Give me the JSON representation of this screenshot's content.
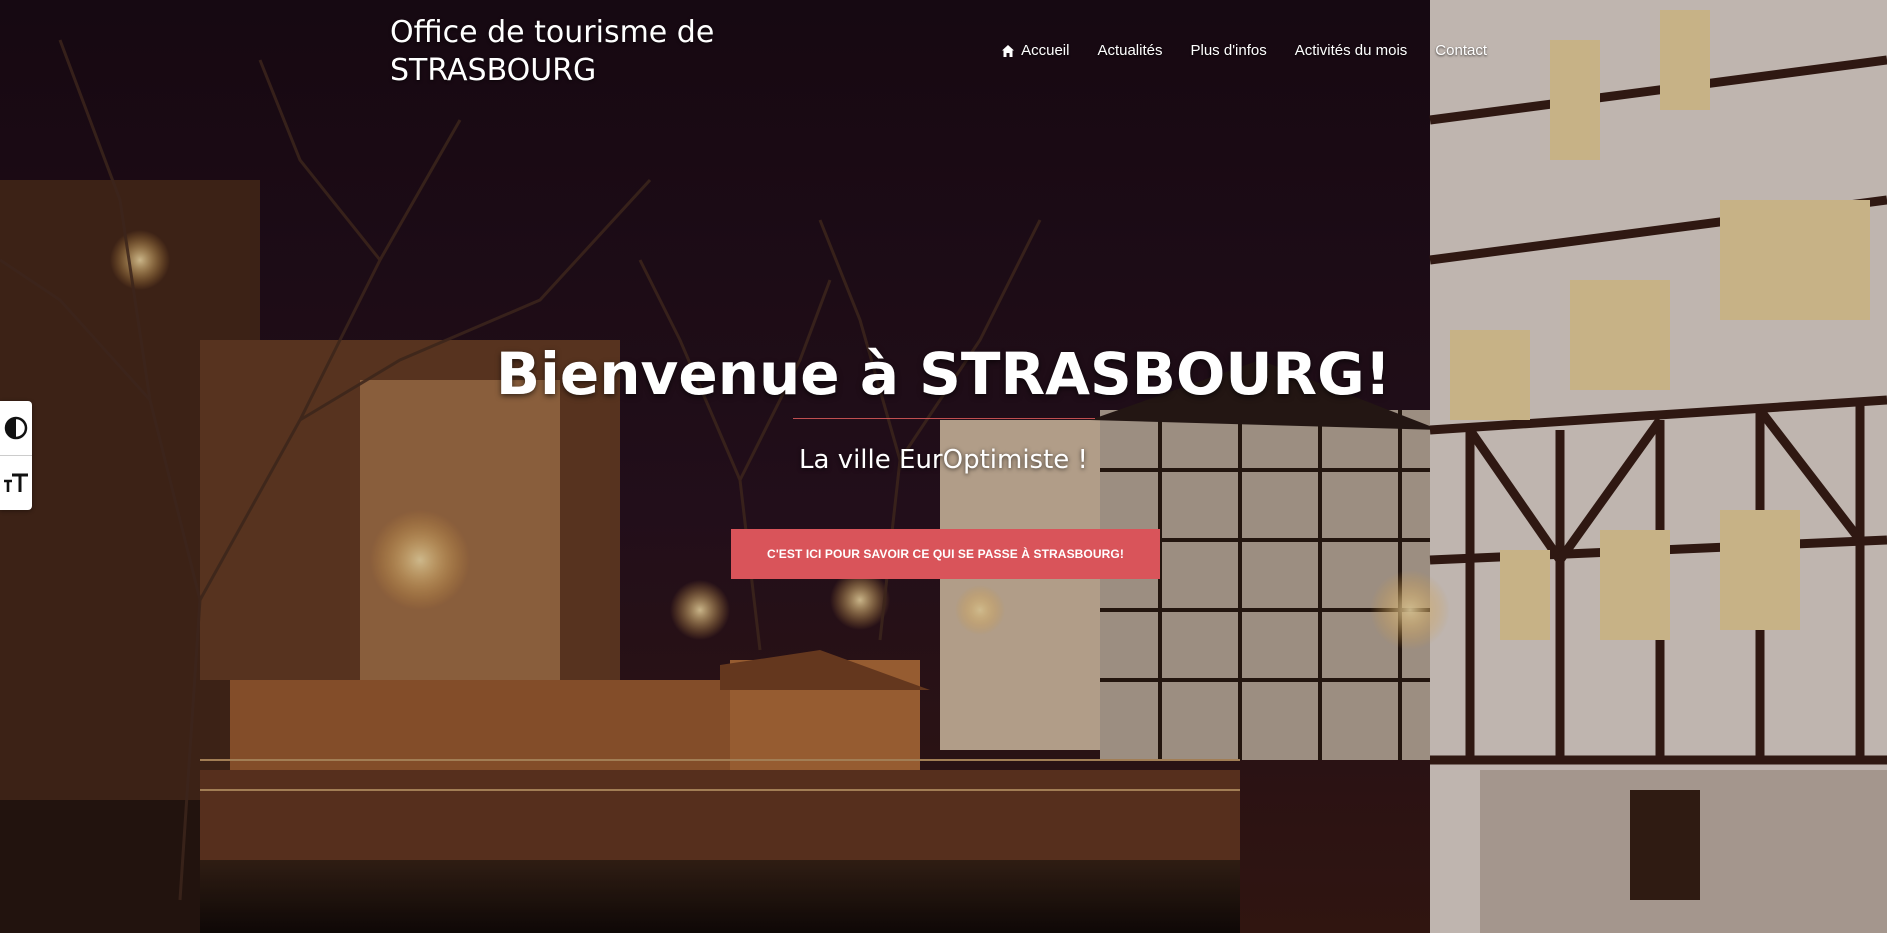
{
  "header": {
    "site_title_line1": "Office de tourisme de",
    "site_title_line2": "STRASBOURG"
  },
  "nav": {
    "items": [
      {
        "label": "Accueil",
        "icon": "home-icon"
      },
      {
        "label": "Actualités"
      },
      {
        "label": "Plus d'infos"
      },
      {
        "label": "Activités du mois"
      },
      {
        "label": "Contact"
      }
    ]
  },
  "hero": {
    "title": "Bienvenue à STRASBOURG!",
    "subtitle": "La ville EurOptimiste !",
    "cta_label": "C'EST ICI POUR SAVOIR CE QUI SE PASSE À STRASBOURG!"
  },
  "accessibility": {
    "contrast_icon": "contrast-icon",
    "text_size_icon": "text-size-icon"
  },
  "colors": {
    "accent": "#d9545a",
    "text": "#ffffff"
  }
}
